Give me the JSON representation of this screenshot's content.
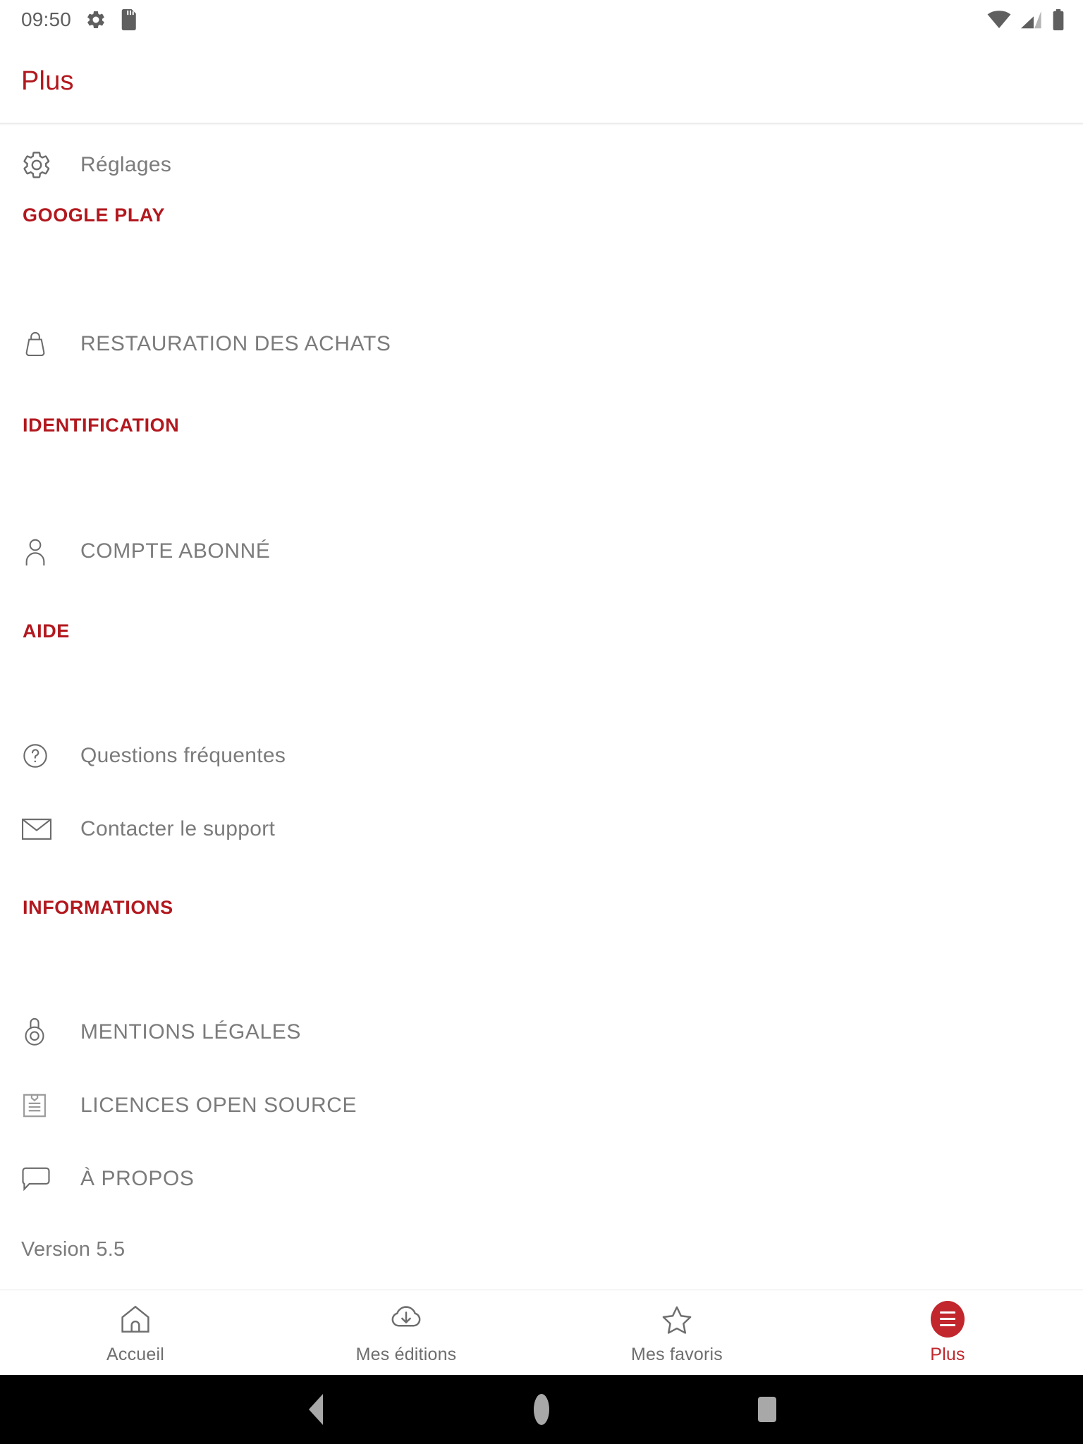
{
  "status_bar": {
    "time": "09:50",
    "left_icons": [
      "gear-icon",
      "sd-card-icon"
    ],
    "right_icons": [
      "wifi-icon",
      "cellular-signal-icon",
      "battery-icon"
    ]
  },
  "app_bar": {
    "title": "Plus",
    "title_color": "#b2181e"
  },
  "content": {
    "settings_row": {
      "label": "Réglages",
      "icon": "gear-icon"
    },
    "sections": [
      {
        "header": "GOOGLE PLAY",
        "items": [
          {
            "label": "RESTAURATION DES ACHATS",
            "icon": "shopping-bag-icon"
          }
        ]
      },
      {
        "header": "IDENTIFICATION",
        "items": [
          {
            "label": "COMPTE ABONNÉ",
            "icon": "person-icon"
          }
        ]
      },
      {
        "header": "AIDE",
        "items": [
          {
            "label": "Questions fréquentes",
            "icon": "question-circle-icon"
          },
          {
            "label": "Contacter le support",
            "icon": "envelope-icon"
          }
        ]
      },
      {
        "header": "INFORMATIONS",
        "items": [
          {
            "label": "MENTIONS LÉGALES",
            "icon": "padlock-icon"
          },
          {
            "label": "LICENCES OPEN SOURCE",
            "icon": "clipboard-icon"
          },
          {
            "label": "À PROPOS",
            "icon": "speech-bubble-icon"
          }
        ]
      }
    ],
    "version": "Version 5.5",
    "section_header_color": "#b2181e",
    "item_label_color": "#7b7b7b"
  },
  "bottom_nav": {
    "active_color": "#c1272d",
    "inactive_color": "#6e6e6e",
    "items": [
      {
        "label": "Accueil",
        "icon": "home-icon",
        "active": false
      },
      {
        "label": "Mes éditions",
        "icon": "cloud-download-icon",
        "active": false
      },
      {
        "label": "Mes favoris",
        "icon": "star-outline-icon",
        "active": false
      },
      {
        "label": "Plus",
        "icon": "hamburger-menu-icon",
        "active": true
      }
    ]
  },
  "android_nav": {
    "back": "back-triangle-icon",
    "home": "home-circle-icon",
    "recents": "recents-square-icon"
  }
}
